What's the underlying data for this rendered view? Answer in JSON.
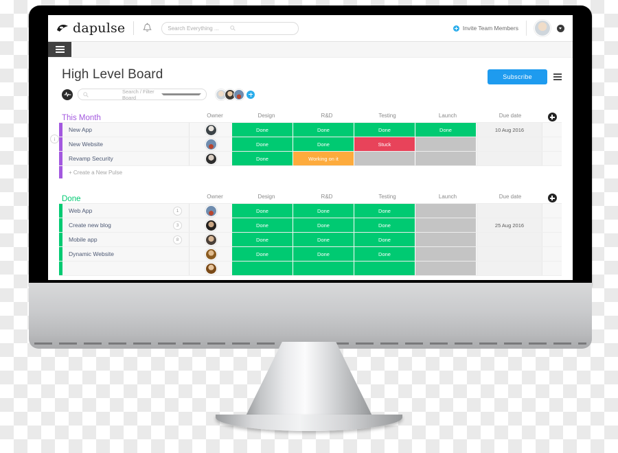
{
  "topbar": {
    "logo_text": "dapulse",
    "logo_icon": "pulse-logo-icon",
    "bell_icon": "bell-icon",
    "search_placeholder": "Search Everything ...",
    "search_icon": "search-icon",
    "invite_label": "Invite Team Members",
    "invite_icon": "plus-circle-icon",
    "avatar_icon": "user-avatar",
    "caret_icon": "chevron-down-icon"
  },
  "menu": {
    "hamburger_icon": "hamburger-menu-icon"
  },
  "board": {
    "title": "High Level Board",
    "subscribe_label": "Subscribe",
    "board_menu_icon": "board-menu-icon",
    "filter_placeholder": "Search / Filter Board",
    "filter_search_icon": "search-icon",
    "filter_caret_icon": "chevron-down-icon",
    "pulse_icon": "pulse-activity-icon",
    "add_member_icon": "add-member-icon",
    "collapse_label": "i"
  },
  "columns": [
    "Owner",
    "Design",
    "R&D",
    "Testing",
    "Launch",
    "Due date"
  ],
  "groups": [
    {
      "name": "This Month",
      "color": "#a358df",
      "add_icon": "add-column-icon",
      "new_pulse_label": "+ Create a New Pulse",
      "rows": [
        {
          "name": "New App",
          "count": "",
          "owner": "ph1",
          "statuses": [
            "Done",
            "Done",
            "Done",
            "Done"
          ],
          "status_keys": [
            "done",
            "done",
            "done",
            "done"
          ],
          "due": "10 Aug 2016"
        },
        {
          "name": "New Website",
          "count": "",
          "owner": "ph2",
          "statuses": [
            "Done",
            "Done",
            "Stuck",
            ""
          ],
          "status_keys": [
            "done",
            "done",
            "stuck",
            "empty"
          ],
          "due": ""
        },
        {
          "name": "Revamp Security",
          "count": "",
          "owner": "ph3",
          "statuses": [
            "Done",
            "Working on it",
            "",
            ""
          ],
          "status_keys": [
            "done",
            "working",
            "empty",
            "empty"
          ],
          "due": ""
        }
      ]
    },
    {
      "name": "Done",
      "color": "#00ca72",
      "add_icon": "add-column-icon",
      "new_pulse_label": "",
      "rows": [
        {
          "name": "Web App",
          "count": "1",
          "owner": "ph2",
          "statuses": [
            "Done",
            "Done",
            "Done",
            ""
          ],
          "status_keys": [
            "done",
            "done",
            "done",
            "empty"
          ],
          "due": ""
        },
        {
          "name": "Create new blog",
          "count": "3",
          "owner": "ph4",
          "statuses": [
            "Done",
            "Done",
            "Done",
            ""
          ],
          "status_keys": [
            "done",
            "done",
            "done",
            "empty"
          ],
          "due": "25 Aug 2016"
        },
        {
          "name": "Mobile app",
          "count": "8",
          "owner": "ph5",
          "statuses": [
            "Done",
            "Done",
            "Done",
            ""
          ],
          "status_keys": [
            "done",
            "done",
            "done",
            "empty"
          ],
          "due": ""
        },
        {
          "name": "Dynamic Website",
          "count": "",
          "owner": "ph6",
          "statuses": [
            "Done",
            "Done",
            "Done",
            ""
          ],
          "status_keys": [
            "done",
            "done",
            "done",
            "empty"
          ],
          "due": ""
        },
        {
          "name": "",
          "count": "",
          "owner": "ph7",
          "statuses": [
            "",
            "",
            "",
            ""
          ],
          "status_keys": [
            "done",
            "done",
            "done",
            "empty"
          ],
          "due": ""
        }
      ]
    }
  ],
  "colors": {
    "done": "#00ca72",
    "stuck": "#e8435a",
    "working": "#fdab3d",
    "empty": "#c4c4c4",
    "accent_blue": "#1e9bef",
    "group_purple": "#a358df"
  }
}
